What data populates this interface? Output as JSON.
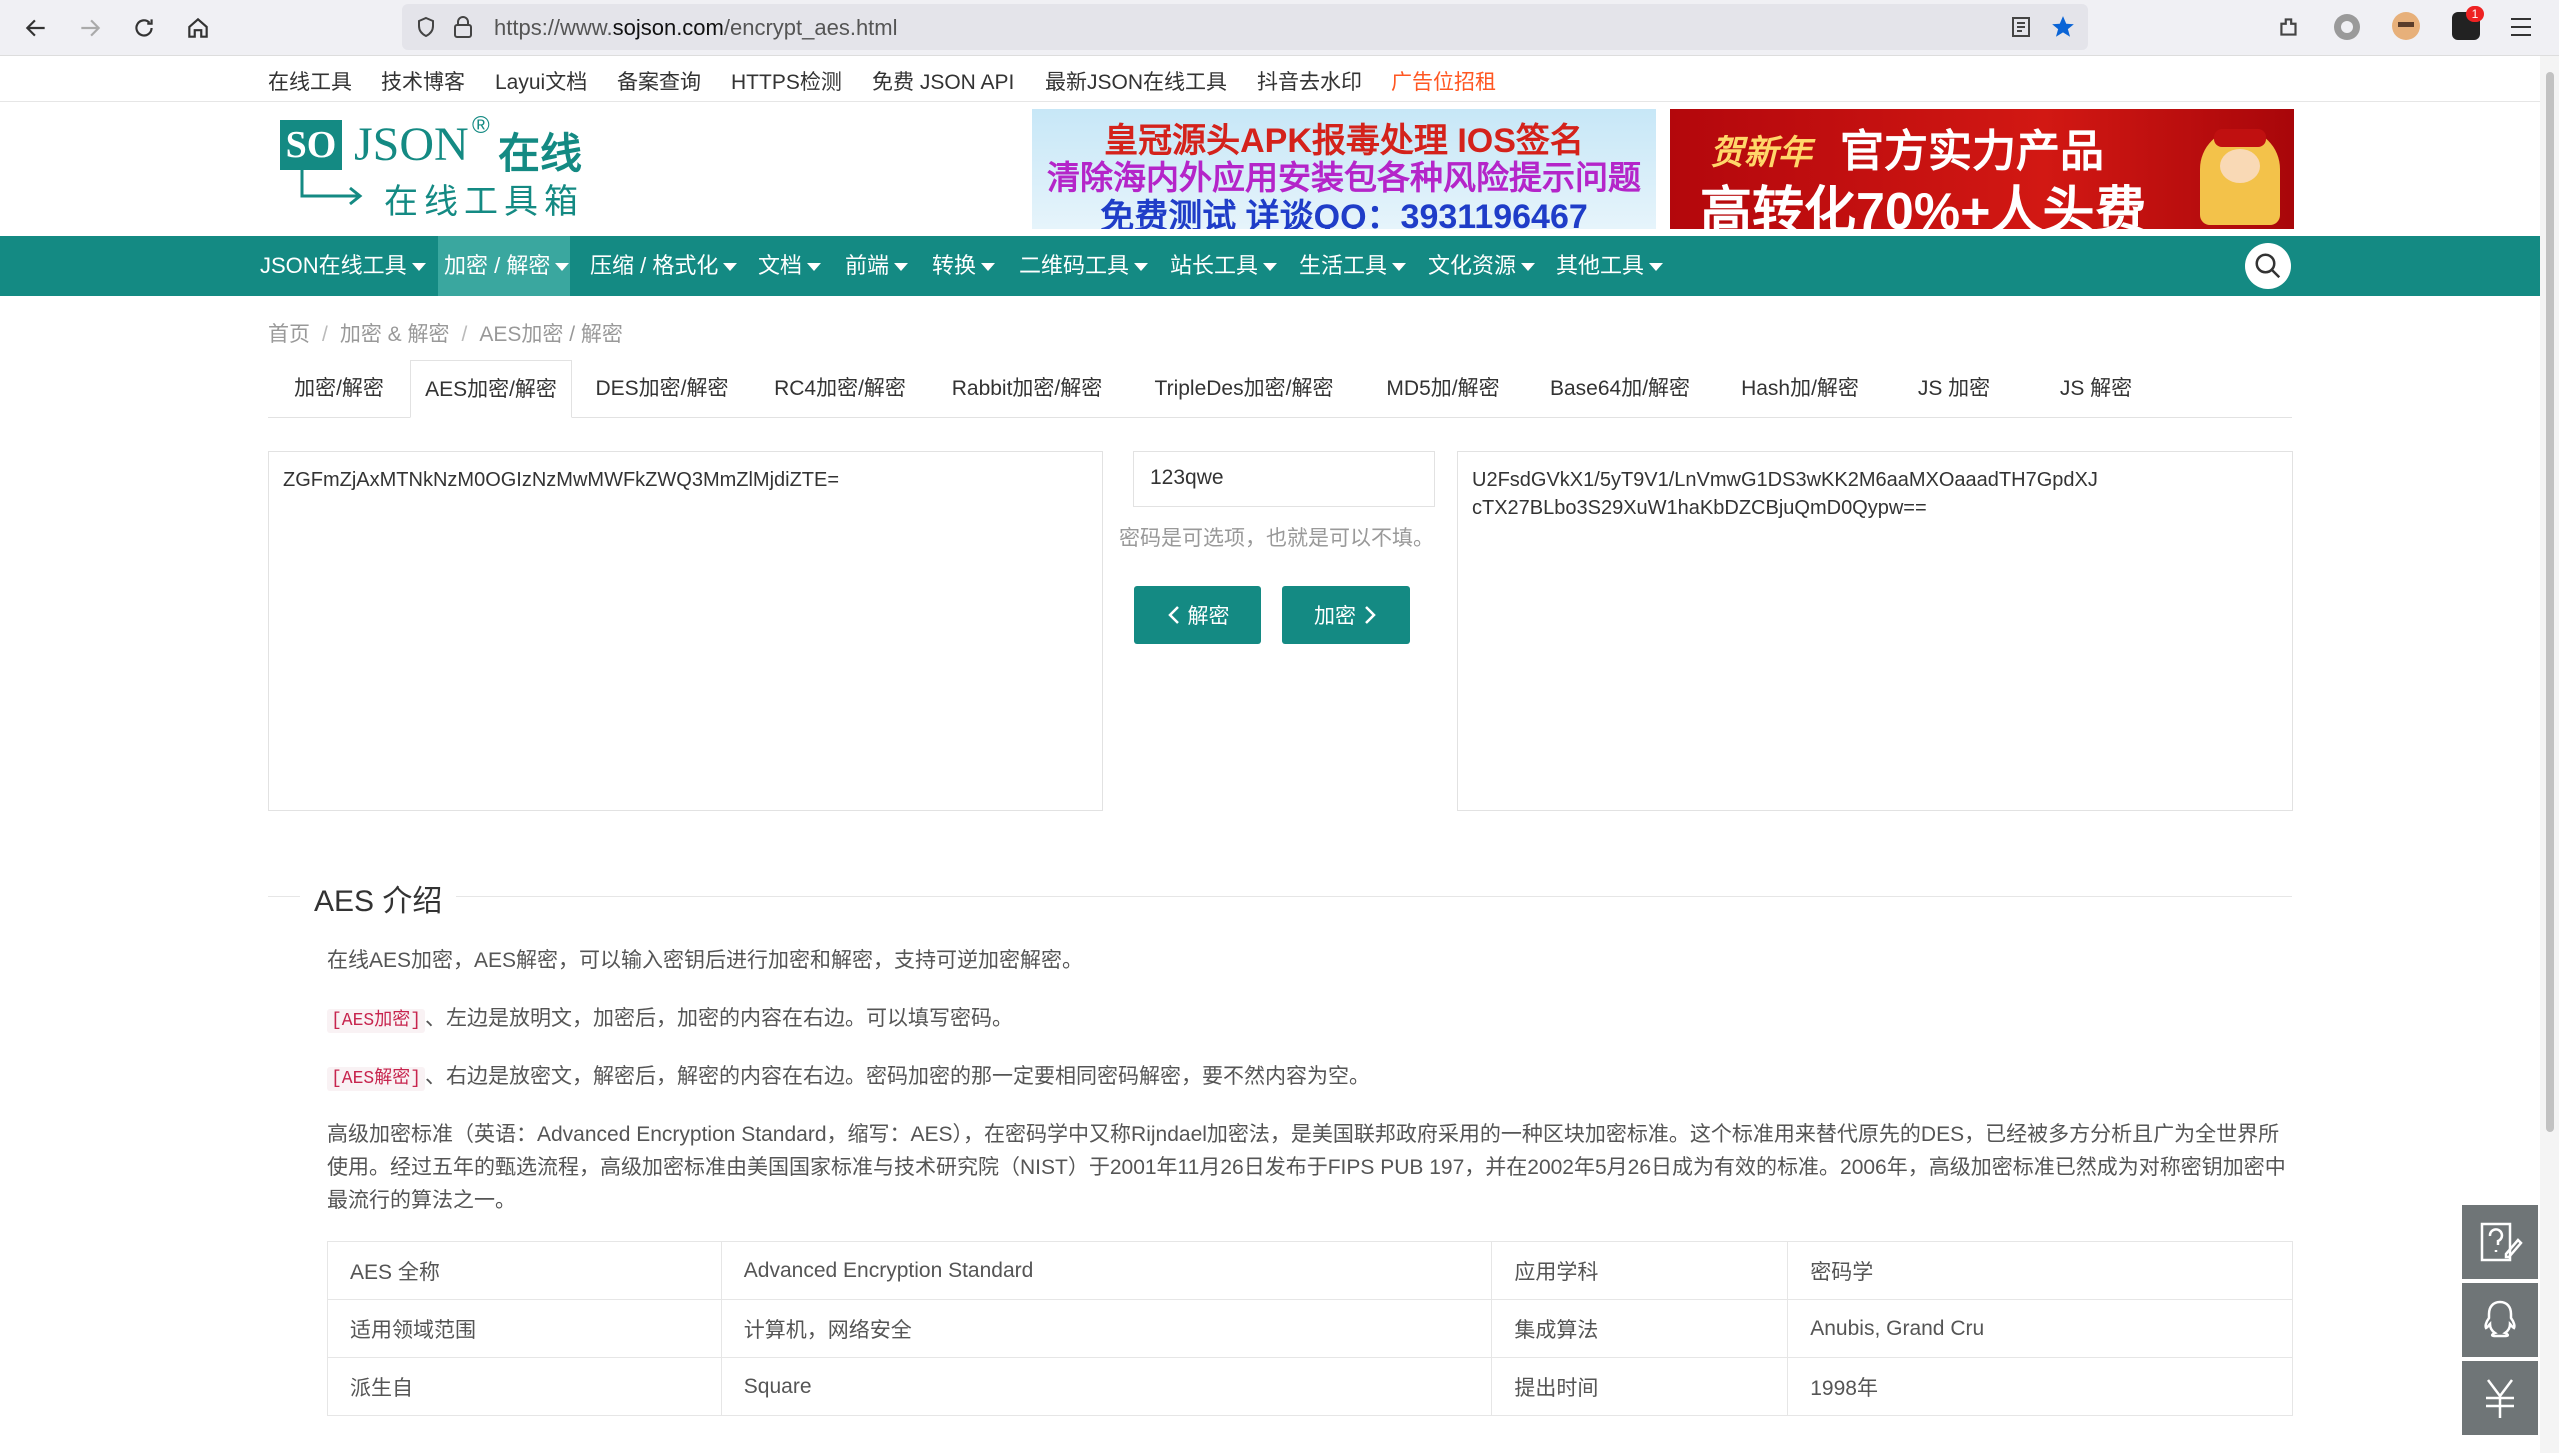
{
  "browser": {
    "url_prefix": "https://www.",
    "url_domain": "sojson.com",
    "url_path": "/encrypt_aes.html",
    "notification_count": "1"
  },
  "top_links": [
    "在线工具",
    "技术博客",
    "Layui文档",
    "备案查询",
    "HTTPS检测",
    "免费 JSON API",
    "最新JSON在线工具",
    "抖音去水印",
    "广告位招租"
  ],
  "logo": {
    "so": "SO",
    "json": "JSON",
    "reg": "®",
    "cn": "在线",
    "tagline": "在线工具箱"
  },
  "ads": {
    "ad1_line1": "皇冠源头APK报毒处理 IOS签名",
    "ad1_line2": "清除海内外应用安装包各种风险提示问题",
    "ad1_line3": "免费测试 详谈QQ：3931196467",
    "ad2_badge": "贺新年",
    "ad2_line1": "官方实力产品",
    "ad2_line2": "高转化70%+人头费"
  },
  "main_nav": [
    "JSON在线工具",
    "加密 / 解密",
    "压缩 / 格式化",
    "文档",
    "前端",
    "转换",
    "二维码工具",
    "站长工具",
    "生活工具",
    "文化资源",
    "其他工具"
  ],
  "breadcrumb": [
    "首页",
    "加密 & 解密",
    "AES加密 / 解密"
  ],
  "tabs": [
    "加密/解密",
    "AES加密/解密",
    "DES加密/解密",
    "RC4加密/解密",
    "Rabbit加密/解密",
    "TripleDes加密/解密",
    "MD5加/解密",
    "Base64加/解密",
    "Hash加/解密",
    "JS 加密",
    "JS 解密"
  ],
  "work": {
    "plaintext": "ZGFmZjAxMTNkNzM0OGIzNzMwMWFkZWQ3MmZlMjdiZTE=",
    "password": "123qwe",
    "password_hint": "密码是可选项，也就是可以不填。",
    "decrypt_label": "解密",
    "encrypt_label": "加密",
    "ciphertext": "U2FsdGVkX1/5yT9V1/LnVmwG1DS3wKK2M6aaMXOaaadTH7GpdXJcTX27BLbo3S29XuW1haKbDZCBjuQmD0Qypw=="
  },
  "intro": {
    "title": "AES 介绍",
    "p1": "在线AES加密，AES解密，可以输入密钥后进行加密和解密，支持可逆加密解密。",
    "p2_code": "[AES加密]",
    "p2_text": "、左边是放明文，加密后，加密的内容在右边。可以填写密码。",
    "p3_code": "[AES解密]",
    "p3_text": "、右边是放密文，解密后，解密的内容在右边。密码加密的那一定要相同密码解密，要不然内容为空。",
    "p4": "高级加密标准（英语：Advanced Encryption Standard，缩写：AES），在密码学中又称Rijndael加密法，是美国联邦政府采用的一种区块加密标准。这个标准用来替代原先的DES，已经被多方分析且广为全世界所使用。经过五年的甄选流程，高级加密标准由美国国家标准与技术研究院（NIST）于2001年11月26日发布于FIPS PUB 197，并在2002年5月26日成为有效的标准。2006年，高级加密标准已然成为对称密钥加密中最流行的算法之一。"
  },
  "table": [
    [
      "AES 全称",
      "Advanced Encryption Standard",
      "应用学科",
      "密码学"
    ],
    [
      "适用领域范围",
      "计算机，网络安全",
      "集成算法",
      "Anubis, Grand Cru"
    ],
    [
      "派生自",
      "Square",
      "提出时间",
      "1998年"
    ]
  ],
  "colors": {
    "nav_bg": "#148a83",
    "nav_active": "#3aa79f",
    "ad_link": "#ff5722",
    "code_text": "#c7254e"
  }
}
